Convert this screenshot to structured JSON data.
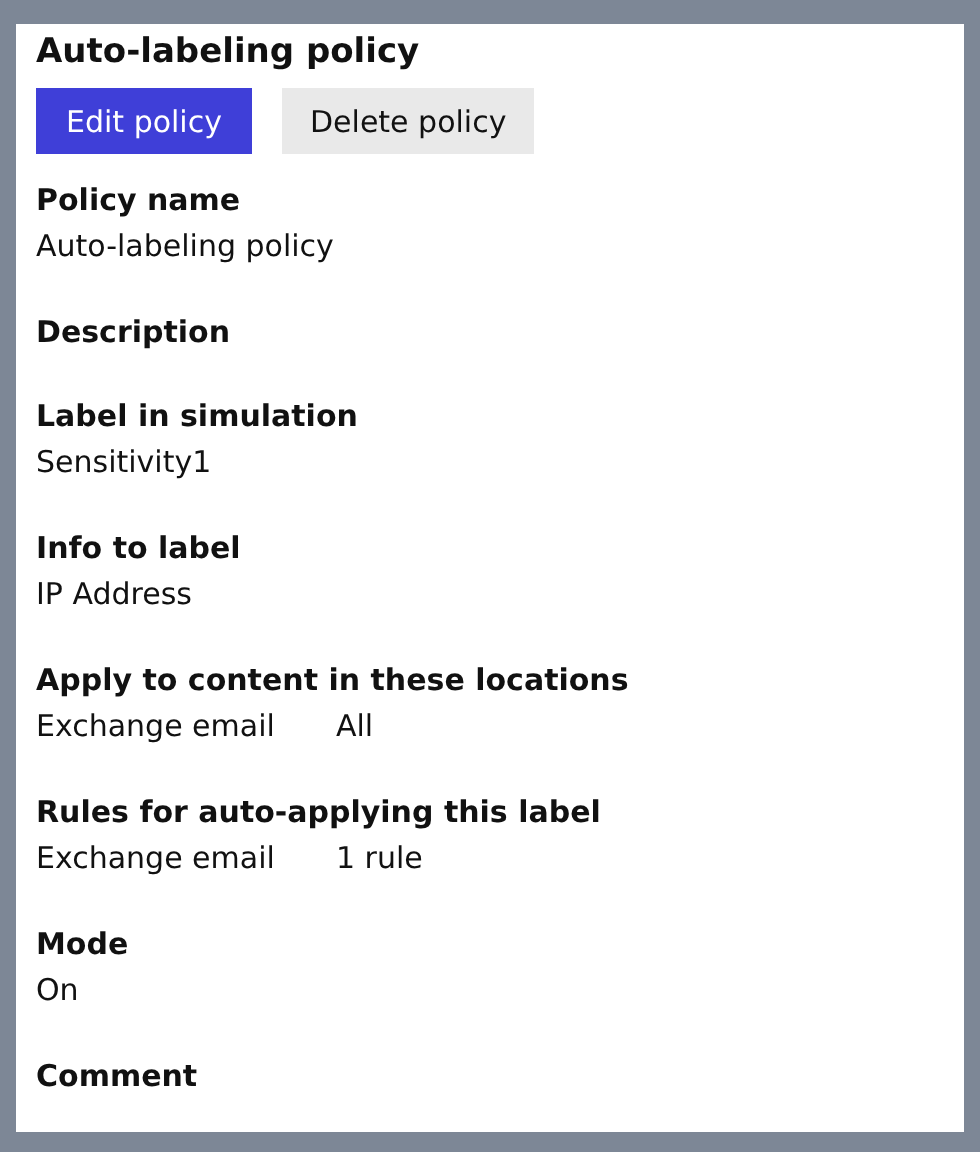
{
  "title": "Auto-labeling policy",
  "buttons": [
    {
      "label": "Edit policy",
      "kind": "primary"
    },
    {
      "label": "Delete policy",
      "kind": "secondary"
    }
  ],
  "fields": [
    {
      "label": "Policy name",
      "rows": [
        [
          "Auto-labeling policy"
        ]
      ]
    },
    {
      "label": "Description"
    },
    {
      "label": "Label in simulation",
      "rows": [
        [
          "Sensitivity1"
        ]
      ]
    },
    {
      "label": "Info to label",
      "rows": [
        [
          "IP Address"
        ]
      ]
    },
    {
      "label": "Apply to content in these locations",
      "rows": [
        [
          "Exchange email",
          "All"
        ]
      ]
    },
    {
      "label": "Rules for auto-applying this label",
      "rows": [
        [
          "Exchange email",
          "1 rule"
        ]
      ]
    },
    {
      "label": "Mode",
      "rows": [
        [
          "On"
        ]
      ]
    },
    {
      "label": "Comment"
    }
  ]
}
